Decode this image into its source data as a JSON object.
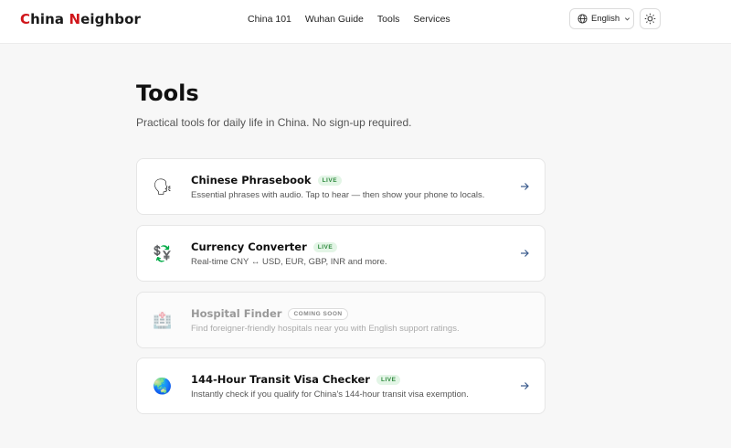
{
  "header": {
    "logo": {
      "c": "C",
      "hina": "hina ",
      "n": "N",
      "eighbor": "eighbor"
    },
    "nav": [
      "China 101",
      "Wuhan Guide",
      "Tools",
      "Services"
    ],
    "language": "English",
    "language_icon": "globe-icon",
    "theme_icon": "sun-icon"
  },
  "main": {
    "title": "Tools",
    "subtitle": "Practical tools for daily life in China. No sign-up required."
  },
  "tools": [
    {
      "icon": "🗣",
      "icon_name": "speaking-head-icon",
      "name": "Chinese Phrasebook",
      "badge": "LIVE",
      "desc": "Essential phrases with audio. Tap to hear — then show your phone to locals."
    },
    {
      "icon": "💱",
      "icon_name": "currency-exchange-icon",
      "name": "Currency Converter",
      "badge": "LIVE",
      "desc": "Real-time CNY ↔ USD, EUR, GBP, INR and more."
    },
    {
      "icon": "🏥",
      "icon_name": "hospital-icon",
      "name": "Hospital Finder",
      "badge": "COMING SOON",
      "desc": "Find foreigner-friendly hospitals near you with English support ratings."
    },
    {
      "icon": "🌏",
      "icon_name": "globe-asia-icon",
      "name": "144-Hour Transit Visa Checker",
      "badge": "LIVE",
      "desc": "Instantly check if you qualify for China's 144-hour transit visa exemption."
    }
  ],
  "colors": {
    "brand_red": "#d0161b",
    "arrow_blue": "#3a5a8c",
    "live_green": "#2f8a3e"
  }
}
